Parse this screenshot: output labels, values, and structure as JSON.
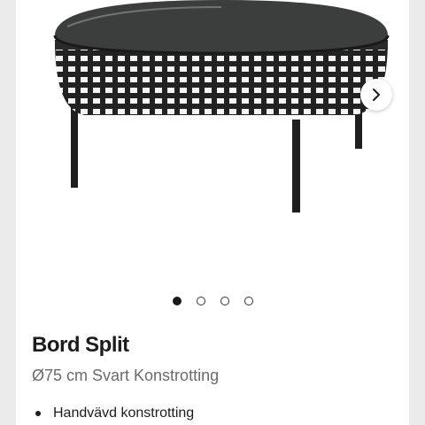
{
  "product": {
    "name": "Bord Split",
    "subtitle": "Ø75 cm Svart Konstrotting",
    "features": [
      "Handvävd konstrotting"
    ]
  },
  "gallery": {
    "image_count": 4,
    "active_index": 0,
    "next_icon": "chevron-right-icon"
  },
  "colors": {
    "background": "#ebebeb",
    "card": "#ffffff",
    "text": "#1c1c1c",
    "muted": "#6b6b6b"
  }
}
